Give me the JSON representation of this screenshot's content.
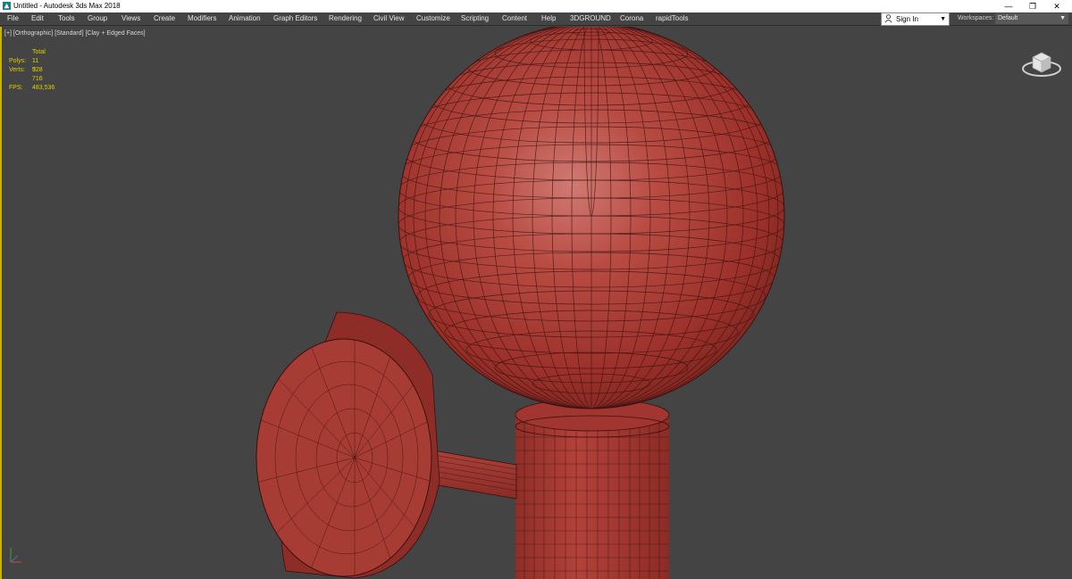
{
  "window": {
    "title": "Untitled - Autodesk 3ds Max 2018",
    "controls": {
      "minimize": "—",
      "restore": "❐",
      "close": "✕"
    }
  },
  "menu": {
    "items": [
      "File",
      "Edit",
      "Tools",
      "Group",
      "Views",
      "Create",
      "Modifiers",
      "Animation",
      "Graph Editors",
      "Rendering",
      "Civil View",
      "Customize",
      "Scripting",
      "Content",
      "Help",
      "3DGROUND",
      "Corona",
      "rapidTools"
    ]
  },
  "account": {
    "sign_in": "Sign In"
  },
  "workspaces": {
    "label": "Workspaces:",
    "value": "Default"
  },
  "viewport": {
    "label": "[+] [Orthographic] [Standard] [Clay + Edged Faces]",
    "stats": {
      "header": "Total",
      "polys_label": "Polys:",
      "polys_value": "11 328",
      "verts_label": "Verts:",
      "verts_value": "5 716",
      "fps_label": "FPS:",
      "fps_value": "483,536"
    }
  },
  "colors": {
    "viewport_bg": "#444444",
    "clay_red": "#b03a32",
    "edge_dark": "#3a1010",
    "stats_yellow": "#e0d000",
    "active_border": "#c9b500"
  }
}
